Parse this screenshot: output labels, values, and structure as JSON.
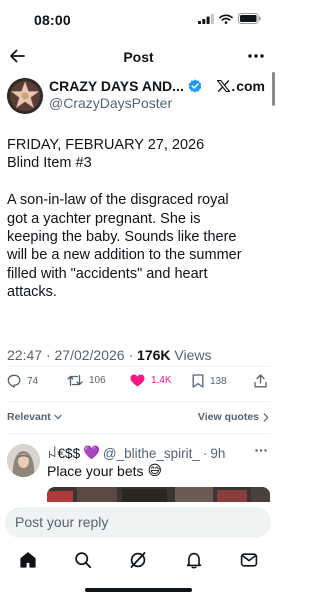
{
  "status_bar": {
    "time": "08:00"
  },
  "nav": {
    "title": "Post",
    "back_icon": "back-arrow-icon",
    "more_icon": "more-horizontal-icon"
  },
  "author": {
    "name": "CRAZY DAYS AND...",
    "handle": "@CrazyDaysPoster",
    "verified": true,
    "source": "com",
    "source_icon": "x-logo-icon"
  },
  "post": {
    "lines": [
      "FRIDAY, FEBRUARY 27, 2026",
      "Blind Item #3",
      "",
      "A son-in-law of the disgraced royal",
      "got a yachter pregnant. She is",
      "keeping the baby. Sounds like there",
      "will be a new addition to the summer",
      "filled with \"accidents\" and heart",
      "attacks."
    ],
    "time": "22:47",
    "date": "27/02/2026",
    "separator": "·",
    "views_count": "176K",
    "views_label": "Views"
  },
  "actions": {
    "replies": "74",
    "reposts": "106",
    "likes": "1.4K",
    "bookmarks": "138",
    "like_color": "#f91880"
  },
  "filters": {
    "relevant": "Relevant",
    "view_quotes": "View quotes"
  },
  "reply": {
    "name": "ꈤ€$$",
    "emoji": "💜",
    "handle": "@_blithe_spirit_",
    "dot": "·",
    "time": "9h",
    "text": "Place your bets",
    "text_emoji": "😅"
  },
  "compose": {
    "placeholder": "Post your reply"
  },
  "tabbar": {
    "items": [
      "home-icon",
      "search-icon",
      "grok-icon",
      "notifications-icon",
      "messages-icon"
    ]
  },
  "colors": {
    "text": "#0f1419",
    "secondary": "#536471",
    "verified": "#1d9bf0",
    "like": "#f91880"
  }
}
